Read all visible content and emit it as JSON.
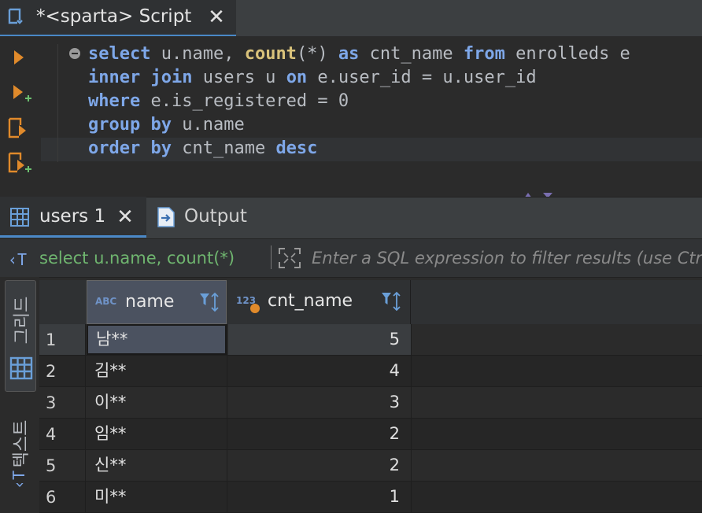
{
  "editor": {
    "tab_title": "*<sparta> Script",
    "code_lines": [
      [
        {
          "t": "select",
          "c": "kw"
        },
        {
          "t": " u.name, ",
          "c": ""
        },
        {
          "t": "count",
          "c": "fn"
        },
        {
          "t": "(*) ",
          "c": ""
        },
        {
          "t": "as",
          "c": "kw"
        },
        {
          "t": " cnt_name ",
          "c": ""
        },
        {
          "t": "from",
          "c": "kw"
        },
        {
          "t": " enrolleds e",
          "c": ""
        }
      ],
      [
        {
          "t": "inner",
          "c": "kw"
        },
        {
          "t": " ",
          "c": ""
        },
        {
          "t": "join",
          "c": "kw"
        },
        {
          "t": " users u ",
          "c": ""
        },
        {
          "t": "on",
          "c": "kw"
        },
        {
          "t": " e.user_id = u.user_id",
          "c": ""
        }
      ],
      [
        {
          "t": "where",
          "c": "kw"
        },
        {
          "t": " e.is_registered = 0",
          "c": ""
        }
      ],
      [
        {
          "t": "group",
          "c": "kw"
        },
        {
          "t": " ",
          "c": ""
        },
        {
          "t": "by",
          "c": "kw"
        },
        {
          "t": " u.name",
          "c": ""
        }
      ],
      [
        {
          "t": "order",
          "c": "kw"
        },
        {
          "t": " ",
          "c": ""
        },
        {
          "t": "by",
          "c": "kw"
        },
        {
          "t": " cnt_name ",
          "c": ""
        },
        {
          "t": "desc",
          "c": "kw"
        }
      ]
    ]
  },
  "results": {
    "tabs": [
      {
        "label": "users 1",
        "active": true
      },
      {
        "label": "Output",
        "active": false
      }
    ],
    "filter": {
      "query_label": "select u.name, count(*)",
      "placeholder": "Enter a SQL expression to filter results (use Ctrl+Space)"
    },
    "side_tabs": [
      {
        "label": "그리드",
        "icon": "grid-icon"
      },
      {
        "label": "텍스트",
        "icon": "text-icon"
      }
    ],
    "columns": [
      {
        "type_tag": "ABC",
        "name": "name"
      },
      {
        "type_tag": "123",
        "name": "cnt_name"
      }
    ],
    "rows": [
      {
        "n": "1",
        "name": "남**",
        "cnt": "5"
      },
      {
        "n": "2",
        "name": "김**",
        "cnt": "4"
      },
      {
        "n": "3",
        "name": "이**",
        "cnt": "3"
      },
      {
        "n": "4",
        "name": "임**",
        "cnt": "2"
      },
      {
        "n": "5",
        "name": "신**",
        "cnt": "2"
      },
      {
        "n": "6",
        "name": "미**",
        "cnt": "1"
      }
    ]
  },
  "colors": {
    "keyword": "#7ea7e8",
    "function": "#d9c27a",
    "accent": "#4a88c7",
    "filter_query": "#6fb56f"
  }
}
